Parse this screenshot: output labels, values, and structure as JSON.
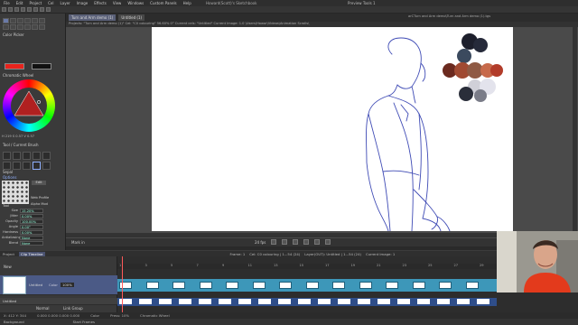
{
  "menu": [
    "File",
    "Edit",
    "Project",
    "Cel",
    "Layer",
    "Image",
    "Effects",
    "View",
    "Windows",
    "Custom Panels",
    "Help"
  ],
  "app_title": "Howard(Scott)'s Sketchbook",
  "navigator_title": "Preview Tools 1",
  "tabs": [
    {
      "label": "Turn and Arm demo (1)",
      "active": true
    },
    {
      "label": "Untitled (1)",
      "active": false
    }
  ],
  "canvas_info": "Projects: \"Turn and Arm demo (1)\"  Cel: \"C0 colouring\"  56.60%  0°  Current cels: \"Untitled\"  Current Image: 1.0 \\Users\\Howar\\Videos\\Animation Scrolls\\",
  "canvas_info2": "arCTurn and Arm demo\\Turn and Arm demo (1).tgs",
  "color_panel": {
    "title": "Color Picker",
    "wheel_title": "Chromatic Wheel",
    "primary": "#e8231c",
    "secondary": "#111111",
    "hsv_readout": "H 219  S 0.57  V 0.57"
  },
  "brush_panel": {
    "title": "Tool / Current Brush",
    "label": "Sepal",
    "options_title": "Options",
    "preview_label": "Tool",
    "profile_label": "Web Profile",
    "alpha_label": "Alpha Mod",
    "edit_label": "Edit",
    "props": [
      {
        "k": "Size",
        "v": "15.20%"
      },
      {
        "k": "Jitter",
        "v": "0.00%"
      },
      {
        "k": "Opacity",
        "v": "100.00%"
      },
      {
        "k": "Angle",
        "v": "0.00°"
      },
      {
        "k": "Hardness",
        "v": "0.00%"
      },
      {
        "k": "Antialiasing",
        "v": "None"
      },
      {
        "k": "Blend",
        "v": "None"
      }
    ]
  },
  "timeline_bar": {
    "mark": "Mark in",
    "fps": "24 fps"
  },
  "bottom_tabs": [
    {
      "label": "Project",
      "active": false
    },
    {
      "label": "Clip Timeline",
      "active": true
    }
  ],
  "track_status": {
    "frame": "Frame: 1",
    "cel": "Cel: C0 colouring | 1...54 (24)",
    "layer": "Layer(OUT): Untitled | 1...54 (24)",
    "current": "Current Image: 1"
  },
  "layers": {
    "new_label": "New",
    "rows": [
      {
        "name": "Untitled",
        "selected": true
      },
      {
        "name": "Untitled",
        "selected": false
      }
    ],
    "color_label": "Color",
    "opacity_value": "100%",
    "blend_label": "Normal",
    "link_label": "Link Group"
  },
  "frame_numbers": [
    1,
    3,
    5,
    7,
    9,
    11,
    13,
    15,
    17,
    19,
    21,
    23,
    25,
    27,
    29
  ],
  "track1_cels": [
    1,
    3,
    5,
    7,
    9,
    11,
    13,
    15,
    17,
    19,
    21,
    23,
    25,
    27
  ],
  "track2_frames": [
    1,
    3,
    5,
    7,
    9,
    11,
    13,
    15,
    17,
    19,
    21,
    23,
    25,
    27,
    29,
    31,
    33,
    35,
    37
  ],
  "palette_swatches": [
    "#1d1f2c",
    "#262a3a",
    "#3b4a5e",
    "#6b2a1f",
    "#a04a32",
    "#8f5a44",
    "#c76a4b",
    "#b23c2a",
    "#d0d0d8",
    "#e3e3ec",
    "#2a2e3a",
    "#7a7c88"
  ],
  "status": {
    "coords": "X: 412  Y: 344",
    "zoom_readout": "0.000  0.000  0.000  0.000",
    "color_label": "Color",
    "press_label": "Press: 10%",
    "wheel_label": "Chromatic Wheel"
  },
  "bottom_bar": {
    "background_label": "Background",
    "start_frames": "Start Frames"
  }
}
